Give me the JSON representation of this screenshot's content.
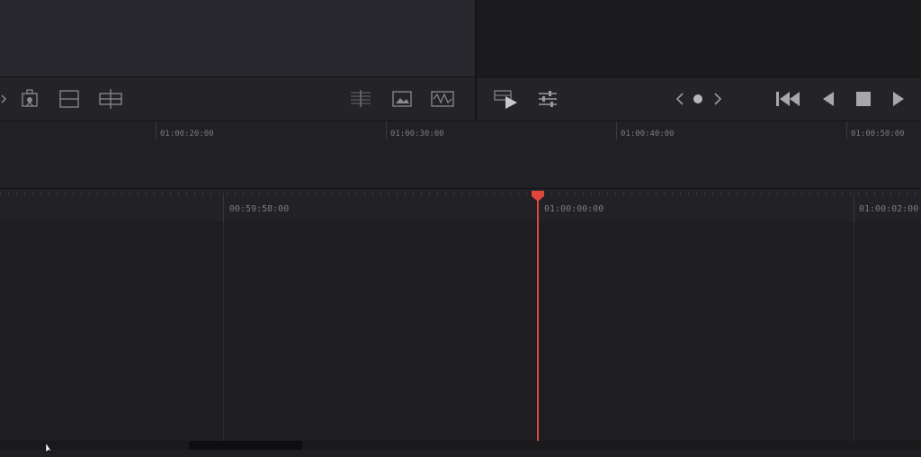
{
  "upper_ruler": {
    "timecodes": [
      "01:00:20:00",
      "01:00:30:00",
      "01:00:40:00",
      "01:00:50:00"
    ]
  },
  "lower_ruler": {
    "timecodes": [
      "00:59:58:00",
      "01:00:00:00",
      "01:00:02:00"
    ]
  },
  "toolbar": {
    "left_icons": [
      "chevron-right-icon",
      "replace-clip-icon",
      "overwrite-icon",
      "place-on-top-icon"
    ],
    "center_icons": [
      "trim-mode-icon",
      "image-icon",
      "waveform-icon"
    ],
    "right_icons": [
      "play-clip-icon",
      "adjustments-icon",
      "previous-icon",
      "dot-icon",
      "next-icon",
      "go-to-start-icon",
      "play-reverse-icon",
      "stop-icon",
      "play-icon"
    ]
  },
  "colors": {
    "playhead": "#e0463b",
    "background": "#1f1e23"
  }
}
